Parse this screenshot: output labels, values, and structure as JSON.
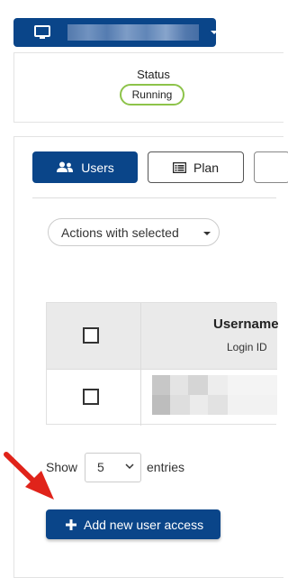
{
  "server": {
    "selector_icon": "monitor-icon",
    "name": ""
  },
  "status": {
    "label": "Status",
    "value": "Running",
    "badge_color": "#8dc34a"
  },
  "tabs": [
    {
      "label": "Users",
      "icon": "users-icon",
      "active": true
    },
    {
      "label": "Plan",
      "icon": "list-icon",
      "active": false
    }
  ],
  "actions": {
    "label": "Actions with selected"
  },
  "table": {
    "columns": [
      {
        "title": "Username",
        "subtitle": "Login ID"
      }
    ],
    "rows": [
      {
        "username": ""
      }
    ]
  },
  "pagination": {
    "show_label": "Show",
    "page_size": "5",
    "entries_label": "entries"
  },
  "add_button": {
    "label": "Add new user access",
    "icon": "plus-icon"
  },
  "colors": {
    "primary": "#0a4589",
    "arrow": "#e0231a"
  }
}
